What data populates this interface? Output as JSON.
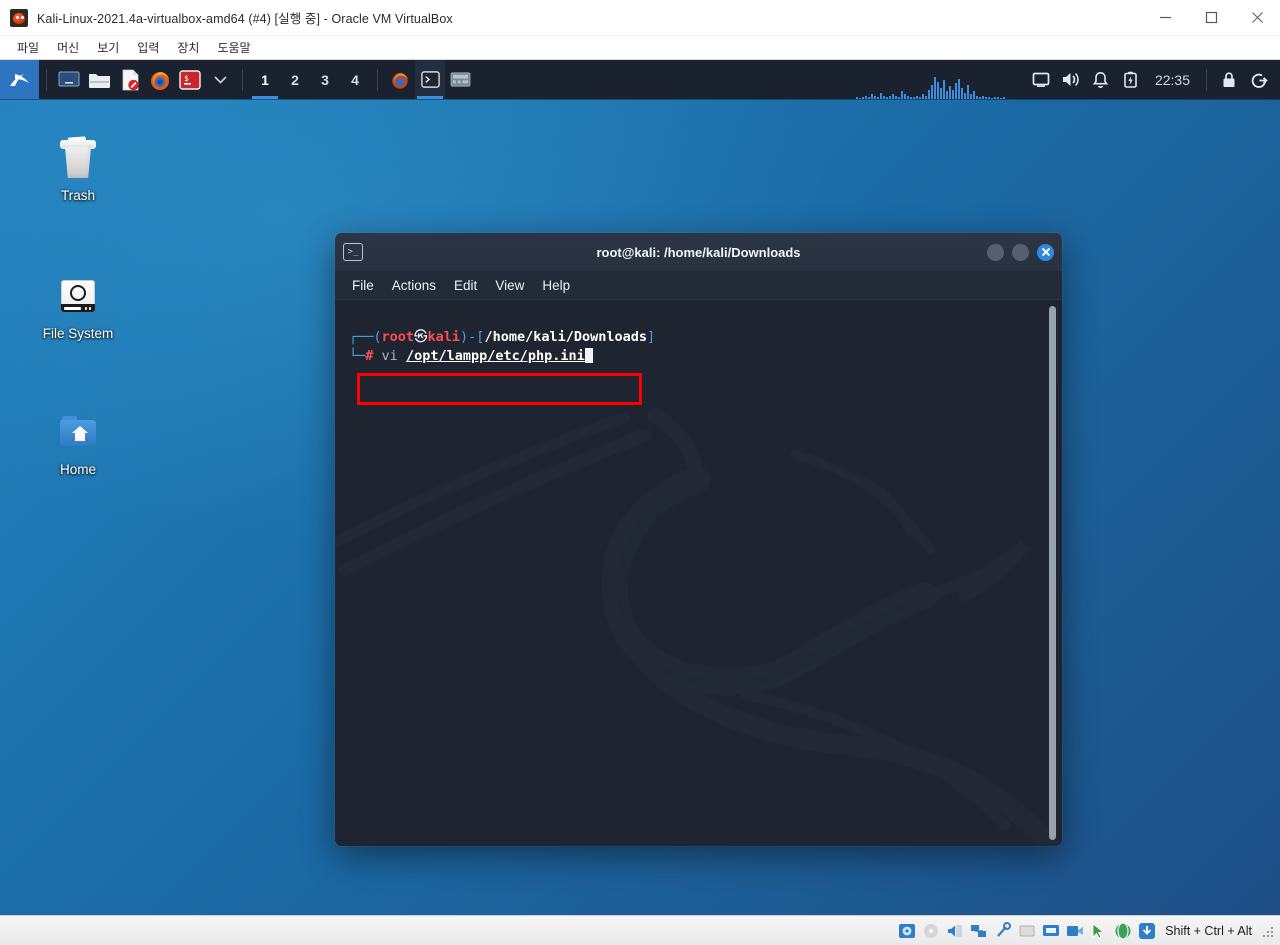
{
  "host": {
    "title": "Kali-Linux-2021.4a-virtualbox-amd64 (#4) [실행 중] - Oracle VM VirtualBox",
    "app_icon": "virtualbox-icon",
    "window_controls": [
      {
        "name": "minimize-button",
        "glyph": "minimize-icon"
      },
      {
        "name": "maximize-button",
        "glyph": "maximize-icon"
      },
      {
        "name": "close-button",
        "glyph": "close-icon"
      }
    ],
    "menu": [
      {
        "label": "파일"
      },
      {
        "label": "머신"
      },
      {
        "label": "보기"
      },
      {
        "label": "입력"
      },
      {
        "label": "장치"
      },
      {
        "label": "도움말"
      }
    ],
    "statusbar": {
      "host_key": "Shift + Ctrl + Alt",
      "devices": [
        {
          "name": "hard-disk-icon"
        },
        {
          "name": "optical-drive-icon"
        },
        {
          "name": "audio-icon"
        },
        {
          "name": "network-icon"
        },
        {
          "name": "usb-icon"
        },
        {
          "name": "shared-folder-icon"
        },
        {
          "name": "display-icon"
        },
        {
          "name": "recording-icon"
        },
        {
          "name": "mouse-integration-icon"
        },
        {
          "name": "host-key-icon"
        },
        {
          "name": "additions-icon"
        }
      ]
    }
  },
  "desktop": {
    "icons": [
      {
        "label": "Trash",
        "name": "desktop-icon-trash",
        "art": "trash"
      },
      {
        "label": "File System",
        "name": "desktop-icon-file-system",
        "art": "filesystem"
      },
      {
        "label": "Home",
        "name": "desktop-icon-home",
        "art": "home"
      }
    ]
  },
  "panel": {
    "menu_button": "kali-menu-icon",
    "launchers": [
      {
        "name": "show-desktop-icon",
        "title": "Show Desktop"
      },
      {
        "name": "file-manager-icon",
        "title": "File Manager"
      },
      {
        "name": "text-editor-icon",
        "title": "Text Editor"
      },
      {
        "name": "firefox-icon",
        "title": "Firefox ESR"
      },
      {
        "name": "terminal-icon",
        "title": "Terminal Emulator"
      },
      {
        "name": "chevron-down-icon",
        "title": "More Applications"
      }
    ],
    "workspaces": [
      {
        "label": "1",
        "active": true
      },
      {
        "label": "2",
        "active": false
      },
      {
        "label": "3",
        "active": false
      },
      {
        "label": "4",
        "active": false
      }
    ],
    "window_buttons": [
      {
        "name": "taskbar-firefox-window",
        "active": false
      },
      {
        "name": "taskbar-terminal-window",
        "active": true
      },
      {
        "name": "taskbar-keyboard-window",
        "active": false
      }
    ],
    "tray": [
      {
        "name": "display-settings-icon"
      },
      {
        "name": "volume-icon"
      },
      {
        "name": "notifications-bell-icon"
      },
      {
        "name": "battery-icon"
      }
    ],
    "clock": "22:35",
    "session": [
      {
        "name": "lock-screen-icon"
      },
      {
        "name": "logout-icon"
      }
    ],
    "cpu_graph": [
      1,
      0,
      1,
      2,
      1,
      3,
      2,
      1,
      4,
      2,
      1,
      2,
      3,
      2,
      1,
      5,
      3,
      2,
      1,
      1,
      2,
      1,
      3,
      2,
      6,
      9,
      14,
      11,
      7,
      12,
      5,
      8,
      6,
      10,
      13,
      7,
      4,
      9,
      3,
      5,
      2,
      1,
      2,
      1,
      1,
      0,
      1,
      1,
      0,
      1
    ]
  },
  "terminal": {
    "title": "root@kali: /home/kali/Downloads",
    "title_icon": "terminal-icon",
    "window_controls": [
      {
        "name": "terminal-minimize-button"
      },
      {
        "name": "terminal-maximize-button"
      },
      {
        "name": "terminal-close-button"
      }
    ],
    "menu": [
      {
        "label": "File"
      },
      {
        "label": "Actions"
      },
      {
        "label": "Edit"
      },
      {
        "label": "View"
      },
      {
        "label": "Help"
      }
    ],
    "prompt": {
      "line1_prefix": "┌──(",
      "user": "root",
      "at": "㉿",
      "hostname": "kali",
      "line1_mid": ")-[",
      "path": "/home/kali/Downloads",
      "line1_suffix": "]",
      "line2_prefix": "└─",
      "sigil": "#",
      "command": "vi",
      "argument": "/opt/lampp/etc/php.ini"
    }
  },
  "annotation": {
    "name": "red-highlight-box",
    "color": "#fe0000",
    "target": "vi /opt/lampp/etc/php.ini"
  },
  "colors": {
    "wallpaper_top": "#2281bc",
    "wallpaper_bottom": "#1d4e86",
    "panel_bg": "#19222e",
    "accent_blue": "#3d8de0",
    "terminal_bg": "#1e2430",
    "annotation_red": "#fe0000"
  }
}
